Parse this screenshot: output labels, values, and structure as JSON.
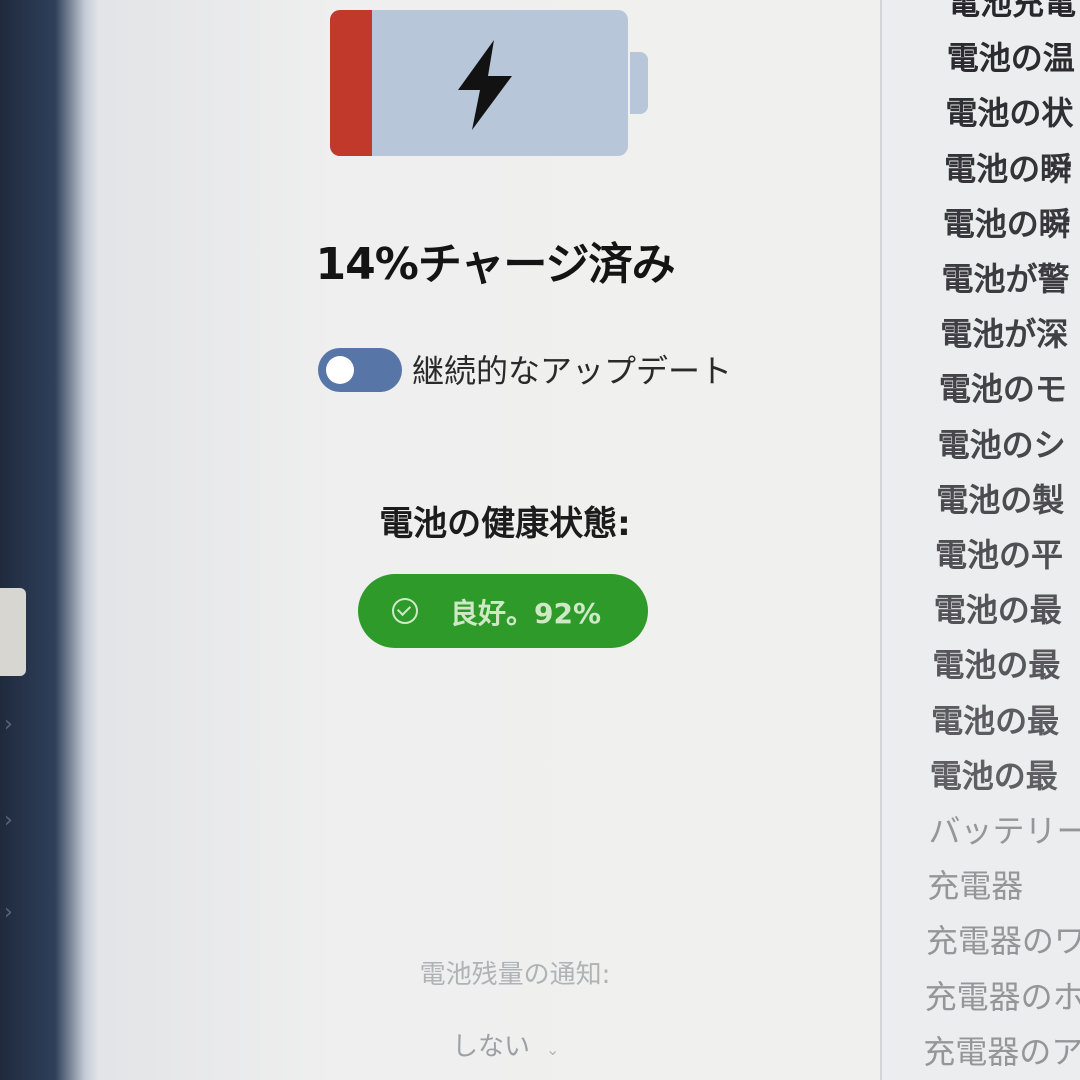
{
  "battery": {
    "charge_percent": 14,
    "fill_color": "#c0392b",
    "body_color": "#b8c6da",
    "icon": "lightning-bolt-icon"
  },
  "status": {
    "charge_text": "14%チャージ済み"
  },
  "toggle": {
    "label": "継続的なアップデート",
    "on": false
  },
  "health": {
    "title": "電池の健康状態:",
    "badge_text": "良好。92%",
    "badge_color": "#2e9a2a",
    "icon": "check-circle-icon"
  },
  "notification": {
    "label": "電池残量の通知:",
    "selected": "しない",
    "icon": "chevron-down-icon"
  },
  "right_list": [
    "電池充電",
    "電池の温",
    "電池の状",
    "電池の瞬",
    "電池の瞬",
    "電池が警",
    "電池が深",
    "電池のモ",
    "電池のシ",
    "電池の製",
    "電池の平",
    "電池の最",
    "電池の最",
    "電池の最",
    "電池の最",
    "バッテリー累",
    "充電器",
    "充電器のワ",
    "充電器のホ",
    "充電器のア"
  ],
  "sidebar": {
    "icons": [
      "chevron-right-icon",
      "chevron-right-icon",
      "chevron-right-icon",
      "chevron-right-icon"
    ]
  }
}
